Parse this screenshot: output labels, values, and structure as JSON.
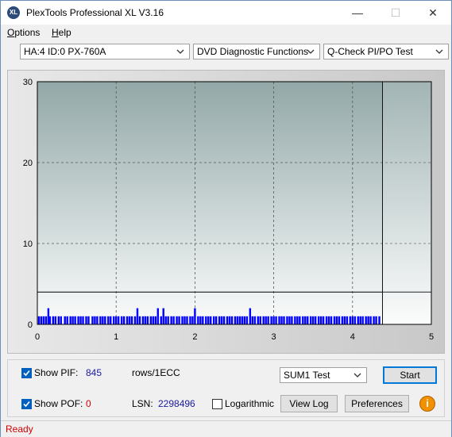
{
  "window": {
    "title": "PlexTools Professional XL V3.16",
    "icon_text": "XL"
  },
  "menu": {
    "options": "ptions",
    "options_u": "O",
    "help": "elp",
    "help_u": "H"
  },
  "combos": {
    "drive": "HA:4 ID:0  PX-760A",
    "function": "DVD Diagnostic Functions",
    "test": "Q-Check PI/PO Test"
  },
  "chart_data": {
    "type": "bar",
    "x_ticks": [
      "0",
      "1",
      "2",
      "3",
      "4",
      "5"
    ],
    "y_ticks": [
      "0",
      "10",
      "20",
      "30"
    ],
    "xlim": [
      0,
      5
    ],
    "ylim": [
      0,
      30
    ],
    "threshold_line": 4,
    "end_marker_x": 4.38,
    "bar_color": "#0000ff",
    "series": [
      {
        "values_x": [
          0.02,
          0.05,
          0.08,
          0.11,
          0.14,
          0.16,
          0.2,
          0.23,
          0.27,
          0.3,
          0.35,
          0.38,
          0.42,
          0.45,
          0.48,
          0.52,
          0.55,
          0.58,
          0.62,
          0.65,
          0.7,
          0.73,
          0.76,
          0.8,
          0.83,
          0.86,
          0.9,
          0.93,
          0.97,
          1.0,
          1.03,
          1.07,
          1.1,
          1.14,
          1.17,
          1.2,
          1.24,
          1.27,
          1.3,
          1.34,
          1.37,
          1.4,
          1.44,
          1.47,
          1.5,
          1.53,
          1.57,
          1.6,
          1.63,
          1.66,
          1.7,
          1.73,
          1.77,
          1.8,
          1.84,
          1.87,
          1.9,
          1.94,
          1.97,
          2.0,
          2.04,
          2.07,
          2.1,
          2.14,
          2.17,
          2.2,
          2.24,
          2.27,
          2.31,
          2.34,
          2.37,
          2.41,
          2.44,
          2.47,
          2.51,
          2.54,
          2.57,
          2.6,
          2.63,
          2.66,
          2.7,
          2.73,
          2.76,
          2.8,
          2.83,
          2.87,
          2.9,
          2.93,
          2.97,
          3.0,
          3.03,
          3.07,
          3.1,
          3.13,
          3.17,
          3.2,
          3.23,
          3.27,
          3.3,
          3.33,
          3.37,
          3.4,
          3.43,
          3.47,
          3.5,
          3.53,
          3.57,
          3.6,
          3.63,
          3.67,
          3.7,
          3.73,
          3.77,
          3.8,
          3.83,
          3.87,
          3.9,
          3.93,
          3.97,
          4.0,
          4.03,
          4.07,
          4.1,
          4.13,
          4.17,
          4.2,
          4.23,
          4.27,
          4.3,
          4.34
        ],
        "values_y": [
          1,
          1,
          1,
          1,
          2,
          1,
          1,
          1,
          1,
          1,
          1,
          1,
          1,
          1,
          1,
          1,
          1,
          1,
          1,
          1,
          1,
          1,
          1,
          1,
          1,
          1,
          1,
          1,
          1,
          1,
          1,
          1,
          1,
          1,
          1,
          1,
          1,
          2,
          1,
          1,
          1,
          1,
          1,
          1,
          1,
          2,
          1,
          2,
          1,
          1,
          1,
          1,
          1,
          1,
          1,
          1,
          1,
          1,
          1,
          2,
          1,
          1,
          1,
          1,
          1,
          1,
          1,
          1,
          1,
          1,
          1,
          1,
          1,
          1,
          1,
          1,
          1,
          1,
          1,
          1,
          2,
          1,
          1,
          1,
          1,
          1,
          1,
          1,
          1,
          1,
          1,
          1,
          1,
          1,
          1,
          1,
          1,
          1,
          1,
          1,
          1,
          1,
          1,
          1,
          1,
          1,
          1,
          1,
          1,
          1,
          1,
          1,
          1,
          1,
          1,
          1,
          1,
          1,
          1,
          1,
          1,
          1,
          1,
          1,
          1,
          1,
          1,
          1,
          1,
          1
        ]
      }
    ]
  },
  "bottom": {
    "show_pif": "Show PIF:",
    "pif_value": "845",
    "rows_label": "rows/1ECC",
    "sum_test": "SUM1 Test",
    "start": "Start",
    "show_pof": "Show POF:",
    "pof_value": "0",
    "lsn_label": "LSN:",
    "lsn_value": "2298496",
    "logarithmic": "Logarithmic",
    "view_log": "View Log",
    "preferences": "Preferences"
  },
  "status": "Ready"
}
